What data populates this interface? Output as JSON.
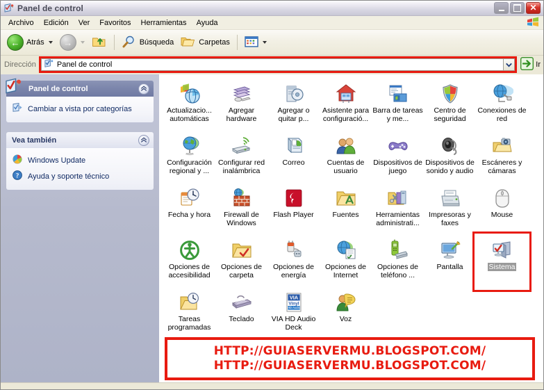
{
  "window": {
    "title": "Panel de control",
    "title_icon": "control-panel-icon",
    "buttons": {
      "minimize": "_",
      "maximize": "□",
      "close": "✕"
    }
  },
  "menubar": {
    "items": [
      {
        "label": "Archivo",
        "name": "menu-archivo"
      },
      {
        "label": "Edición",
        "name": "menu-edicion"
      },
      {
        "label": "Ver",
        "name": "menu-ver"
      },
      {
        "label": "Favoritos",
        "name": "menu-favoritos"
      },
      {
        "label": "Herramientas",
        "name": "menu-herramientas"
      },
      {
        "label": "Ayuda",
        "name": "menu-ayuda"
      }
    ],
    "flag_icon": "windows-flag-icon"
  },
  "toolbar": {
    "back_label": "Atrás",
    "forward_label": "",
    "up_label": "",
    "search_label": "Búsqueda",
    "folders_label": "Carpetas",
    "views_label": ""
  },
  "address_bar": {
    "label": "Dirección",
    "value": "Panel de control",
    "icon": "control-panel-icon",
    "dropdown_icon": "chevron-down-icon",
    "go_label": "Ir",
    "go_icon": "go-arrow-icon",
    "highlight_color": "#e81b10"
  },
  "sidebar": {
    "panels": [
      {
        "title": "Panel de control",
        "name": "panel-control-task-panel",
        "style": "dark",
        "header_icon": "control-panel-icon",
        "collapse_icon": "chevron-up-icon",
        "rows": [
          {
            "label": "Cambiar a vista por categorías",
            "icon": "category-view-icon",
            "name": "link-cambiar-vista-categorias"
          }
        ]
      },
      {
        "title": "Vea también",
        "name": "vea-tambien-panel",
        "style": "light",
        "collapse_icon": "chevron-up-icon",
        "rows": [
          {
            "label": "Windows Update",
            "icon": "windows-update-icon",
            "name": "link-windows-update"
          },
          {
            "label": "Ayuda y soporte técnico",
            "icon": "help-support-icon",
            "name": "link-ayuda-soporte"
          }
        ]
      }
    ]
  },
  "content": {
    "items": [
      {
        "label": "Actualizacio... automáticas",
        "icon": "automatic-updates-icon",
        "name": "cp-actualizaciones-automaticas",
        "selected": false
      },
      {
        "label": "Agregar hardware",
        "icon": "add-hardware-icon",
        "name": "cp-agregar-hardware",
        "selected": false
      },
      {
        "label": "Agregar o quitar p...",
        "icon": "add-remove-programs-icon",
        "name": "cp-agregar-quitar-programas",
        "selected": false
      },
      {
        "label": "Asistente para configuració...",
        "icon": "network-setup-wizard-icon",
        "name": "cp-asistente-configuracion",
        "selected": false
      },
      {
        "label": "Barra de tareas y me...",
        "icon": "taskbar-startmenu-icon",
        "name": "cp-barra-tareas",
        "selected": false
      },
      {
        "label": "Centro de seguridad",
        "icon": "security-center-icon",
        "name": "cp-centro-seguridad",
        "selected": false
      },
      {
        "label": "Conexiones de red",
        "icon": "network-connections-icon",
        "name": "cp-conexiones-red",
        "selected": false
      },
      {
        "label": "Configuración regional y ...",
        "icon": "regional-settings-icon",
        "name": "cp-configuracion-regional",
        "selected": false
      },
      {
        "label": "Configurar red inalámbrica",
        "icon": "wireless-network-icon",
        "name": "cp-configurar-red-inalambrica",
        "selected": false
      },
      {
        "label": "Correo",
        "icon": "mail-icon",
        "name": "cp-correo",
        "selected": false
      },
      {
        "label": "Cuentas de usuario",
        "icon": "user-accounts-icon",
        "name": "cp-cuentas-usuario",
        "selected": false
      },
      {
        "label": "Dispositivos de juego",
        "icon": "game-controller-icon",
        "name": "cp-dispositivos-juego",
        "selected": false
      },
      {
        "label": "Dispositivos de sonido y audio",
        "icon": "sounds-audio-icon",
        "name": "cp-dispositivos-sonido-audio",
        "selected": false
      },
      {
        "label": "Escáneres y cámaras",
        "icon": "scanners-cameras-icon",
        "name": "cp-escaneres-camaras",
        "selected": false
      },
      {
        "label": "Fecha y hora",
        "icon": "date-time-icon",
        "name": "cp-fecha-hora",
        "selected": false
      },
      {
        "label": "Firewall de Windows",
        "icon": "windows-firewall-icon",
        "name": "cp-firewall-windows",
        "selected": false
      },
      {
        "label": "Flash Player",
        "icon": "flash-player-icon",
        "name": "cp-flash-player",
        "selected": false
      },
      {
        "label": "Fuentes",
        "icon": "fonts-folder-icon",
        "name": "cp-fuentes",
        "selected": false
      },
      {
        "label": "Herramientas administrati...",
        "icon": "administrative-tools-icon",
        "name": "cp-herramientas-administrativas",
        "selected": false
      },
      {
        "label": "Impresoras y faxes",
        "icon": "printers-faxes-icon",
        "name": "cp-impresoras-faxes",
        "selected": false
      },
      {
        "label": "Mouse",
        "icon": "mouse-icon",
        "name": "cp-mouse",
        "selected": false
      },
      {
        "label": "Opciones de accesibilidad",
        "icon": "accessibility-icon",
        "name": "cp-opciones-accesibilidad",
        "selected": false
      },
      {
        "label": "Opciones de carpeta",
        "icon": "folder-options-icon",
        "name": "cp-opciones-carpeta",
        "selected": false
      },
      {
        "label": "Opciones de energía",
        "icon": "power-options-icon",
        "name": "cp-opciones-energia",
        "selected": false
      },
      {
        "label": "Opciones de Internet",
        "icon": "internet-options-icon",
        "name": "cp-opciones-internet",
        "selected": false
      },
      {
        "label": "Opciones de teléfono ...",
        "icon": "phone-modem-icon",
        "name": "cp-opciones-telefono",
        "selected": false
      },
      {
        "label": "Pantalla",
        "icon": "display-icon",
        "name": "cp-pantalla",
        "selected": false
      },
      {
        "label": "Sistema",
        "icon": "system-icon",
        "name": "cp-sistema",
        "selected": true
      },
      {
        "label": "Tareas programadas",
        "icon": "scheduled-tasks-icon",
        "name": "cp-tareas-programadas",
        "selected": false
      },
      {
        "label": "Teclado",
        "icon": "keyboard-icon",
        "name": "cp-teclado",
        "selected": false
      },
      {
        "label": "VIA HD Audio Deck",
        "icon": "via-hd-audio-icon",
        "name": "cp-via-hd-audio-deck",
        "selected": false
      },
      {
        "label": "Voz",
        "icon": "speech-icon",
        "name": "cp-voz",
        "selected": false
      }
    ]
  },
  "watermark": {
    "line1": "HTTP://GUIASERVERMU.BLOGSPOT.COM/",
    "line2": "HTTP://GUIASERVERMU.BLOGSPOT.COM/",
    "color": "#e81b10"
  }
}
